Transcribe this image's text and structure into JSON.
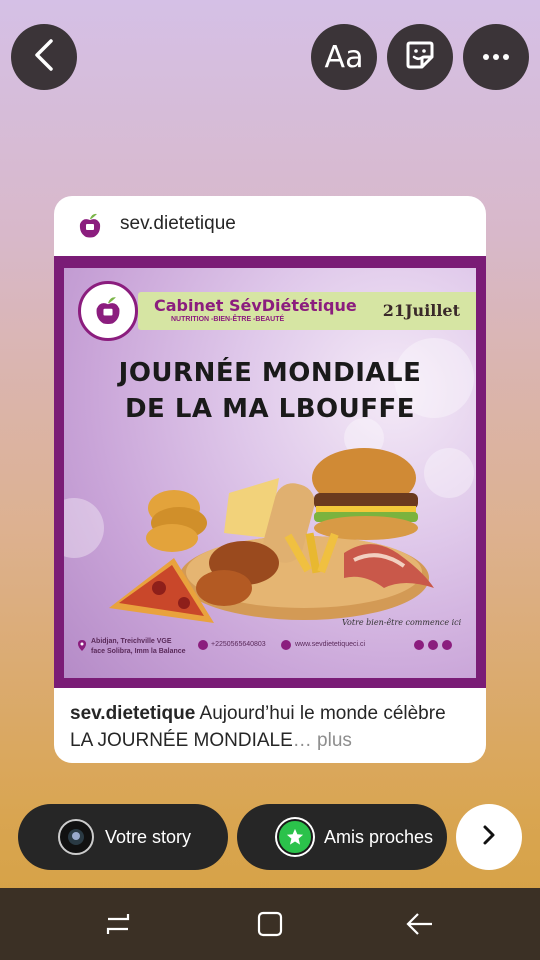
{
  "top_bar": {
    "back_icon": "chevron-left-icon",
    "text_label": "Aa",
    "sticker_icon": "sticker-icon",
    "more_icon": "more-horizontal-icon"
  },
  "post": {
    "username": "sev.dietetique",
    "flyer": {
      "cabinet": "Cabinet SévDiététique",
      "subtitle": "NUTRITION -BIEN-ÊTRE -BEAUTÉ",
      "date": "21Juillet",
      "headline_1": "JOURNÉE MONDIALE",
      "headline_2": "DE LA MA LBOUFFE",
      "slogan": "Votre bien-être commence ici",
      "address_1": "Abidjan, Treichville VGE",
      "address_2": "face Solibra, Imm la Balance",
      "phone": "+2250565640803",
      "website": "www.sevdietetiqueci.ci"
    },
    "caption_user": "sev.dietetique",
    "caption_text": " Aujourd’hui le monde célèbre LA JOURNÉE MONDIALE",
    "caption_more": "… plus"
  },
  "share": {
    "your_story": "Votre story",
    "close_friends": "Amis proches"
  },
  "colors": {
    "brand_purple": "#8b1d7e",
    "pill_bg": "#262626",
    "close_friends_green": "#2bc24b"
  }
}
